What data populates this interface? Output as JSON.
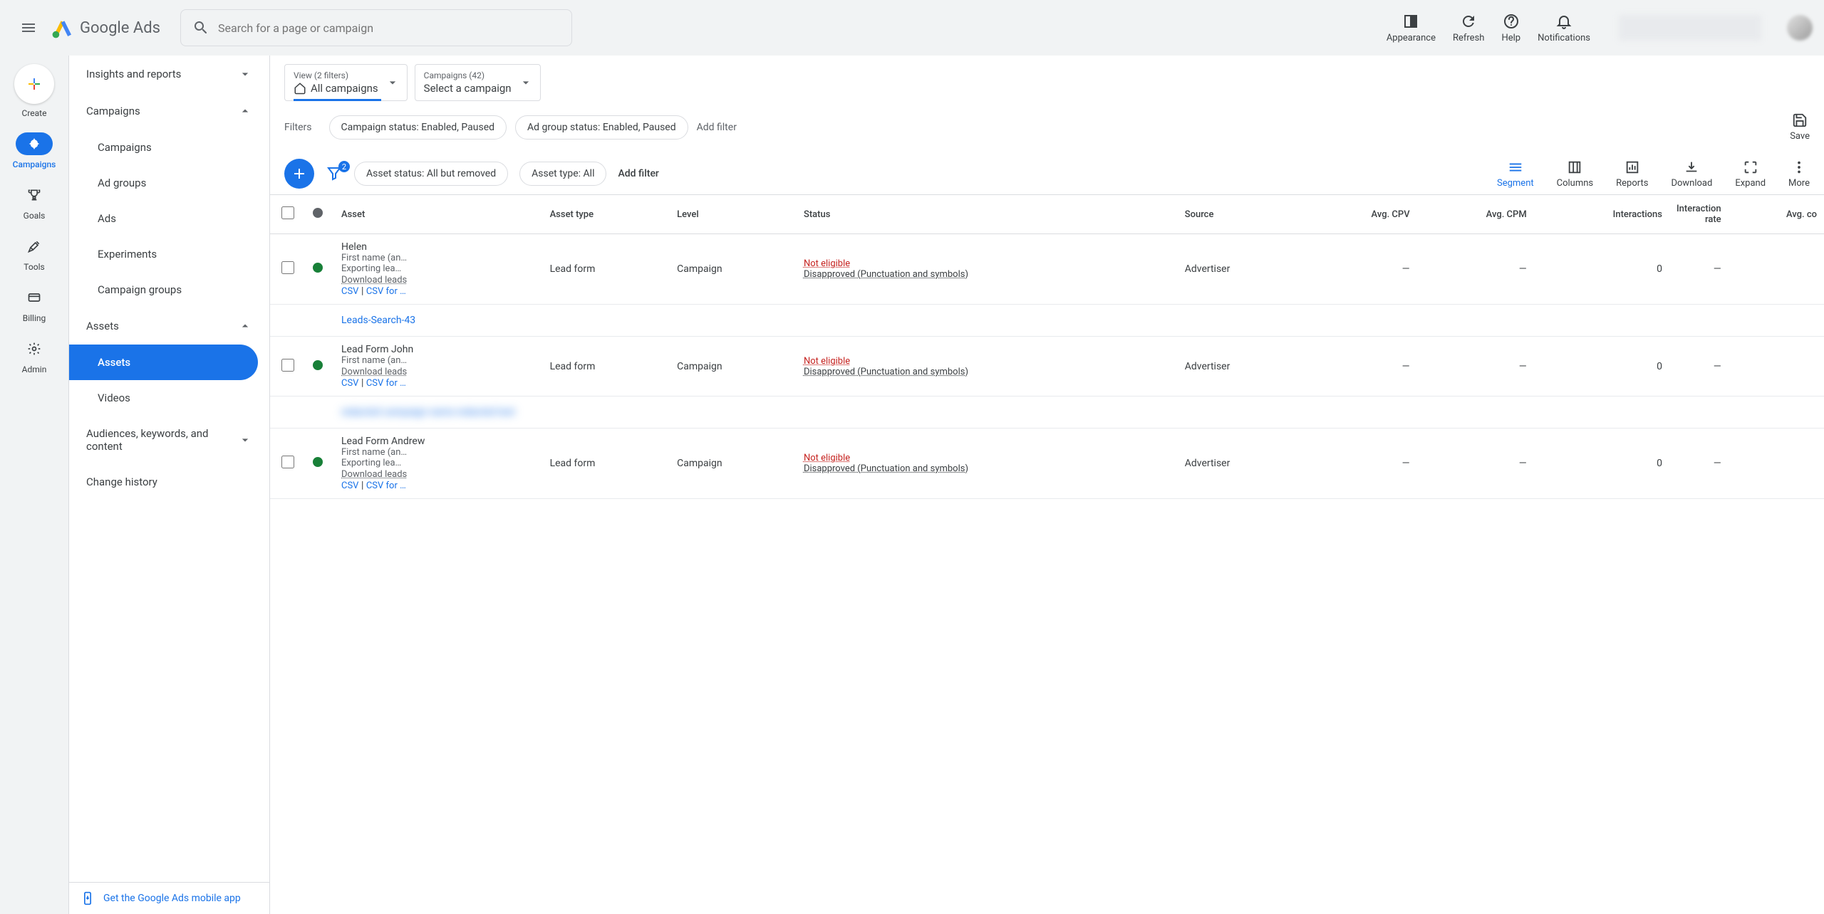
{
  "header": {
    "logo_text": "Google Ads",
    "search_placeholder": "Search for a page or campaign",
    "actions": {
      "appearance": "Appearance",
      "refresh": "Refresh",
      "help": "Help",
      "notifications": "Notifications"
    }
  },
  "rail": {
    "create": "Create",
    "campaigns": "Campaigns",
    "goals": "Goals",
    "tools": "Tools",
    "billing": "Billing",
    "admin": "Admin"
  },
  "sidebar": {
    "insights": "Insights and reports",
    "campaigns_section": "Campaigns",
    "campaigns": "Campaigns",
    "ad_groups": "Ad groups",
    "ads": "Ads",
    "experiments": "Experiments",
    "campaign_groups": "Campaign groups",
    "assets_section": "Assets",
    "assets": "Assets",
    "videos": "Videos",
    "audiences": "Audiences, keywords, and content",
    "change_history": "Change history",
    "mobile_app": "Get the Google Ads mobile app"
  },
  "view_selectors": {
    "view_label": "View (2 filters)",
    "view_value": "All campaigns",
    "campaigns_label": "Campaigns (42)",
    "campaigns_value": "Select a campaign"
  },
  "filters": {
    "label": "Filters",
    "chip1": "Campaign status: Enabled, Paused",
    "chip2": "Ad group status: Enabled, Paused",
    "add": "Add filter",
    "save": "Save"
  },
  "toolbar": {
    "filter_count": "2",
    "chip_asset_status": "Asset status: All but removed",
    "chip_asset_type": "Asset type: All",
    "add_filter": "Add filter",
    "segment": "Segment",
    "columns": "Columns",
    "reports": "Reports",
    "download": "Download",
    "expand": "Expand",
    "more": "More"
  },
  "table": {
    "headers": {
      "asset": "Asset",
      "asset_type": "Asset type",
      "level": "Level",
      "status": "Status",
      "source": "Source",
      "avg_cpv": "Avg. CPV",
      "avg_cpm": "Avg. CPM",
      "interactions": "Interactions",
      "interaction_rate": "Interaction rate",
      "avg_co": "Avg. co"
    },
    "common": {
      "lead_form": "Lead form",
      "campaign": "Campaign",
      "advertiser": "Advertiser",
      "download_leads": "Download leads",
      "csv": "CSV",
      "csv_for": "CSV for …",
      "not_eligible": "Not eligible",
      "disapproved": "Disapproved (Punctuation and symbols)",
      "dash": "—",
      "zero": "0",
      "pipe": " | "
    },
    "rows": [
      {
        "name": "Helen",
        "sub1": "First name (an…",
        "sub2": "Exporting lea…"
      },
      {
        "name": "Lead Form John",
        "sub1": "First name (an…",
        "sub2": ""
      },
      {
        "name": "Lead Form Andrew",
        "sub1": "First name (an…",
        "sub2": "Exporting lea…"
      }
    ],
    "group_link": "Leads-Search-43",
    "blurred_group": "redacted campaign name redacted text"
  }
}
